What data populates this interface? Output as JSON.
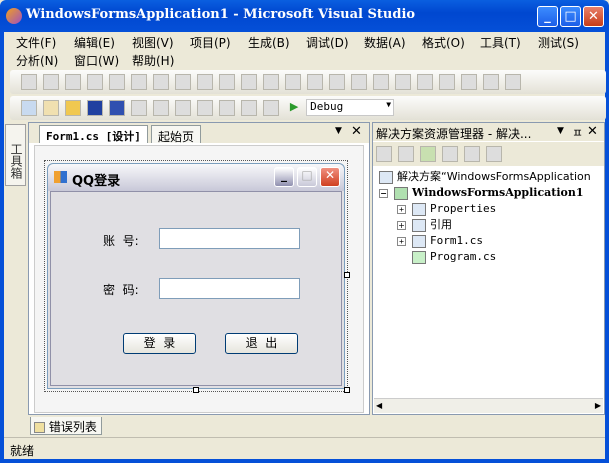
{
  "window": {
    "title": "WindowsFormsApplication1 - Microsoft Visual Studio"
  },
  "menu": [
    "文件(F)",
    "编辑(E)",
    "视图(V)",
    "项目(P)",
    "生成(B)",
    "调试(D)",
    "数据(A)",
    "格式(O)",
    "工具(T)",
    "测试(S)",
    "分析(N)",
    "窗口(W)",
    "帮助(H)"
  ],
  "toolbar": {
    "config": "Debug"
  },
  "toolbox": {
    "label": "工具箱"
  },
  "designer": {
    "tabs": [
      "Form1.cs [设计]",
      "起始页"
    ]
  },
  "form": {
    "title": "QQ登录",
    "account_label": "账  号:",
    "password_label": "密  码:",
    "account_value": "",
    "password_value": "",
    "login": "登  录",
    "exit": "退  出"
  },
  "solution": {
    "header": "解决方案资源管理器 - 解决...",
    "items": [
      "解决方案“WindowsFormsApplication",
      "WindowsFormsApplication1",
      "Properties",
      "引用",
      "Form1.cs",
      "Program.cs"
    ]
  },
  "bottom": {
    "error_tab": "错误列表"
  },
  "status": "就绪"
}
